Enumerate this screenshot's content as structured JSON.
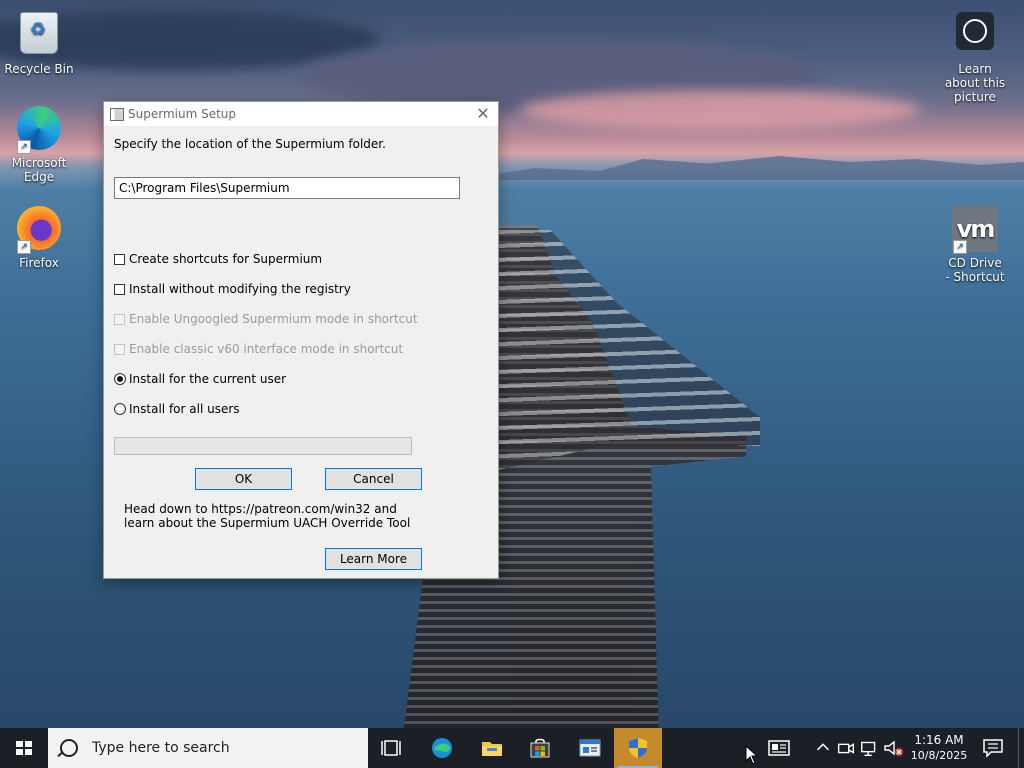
{
  "desktop": {
    "icons": [
      {
        "label": "Recycle Bin"
      },
      {
        "label": "Microsoft Edge"
      },
      {
        "label": "Firefox"
      },
      {
        "label": "Learn about this picture"
      },
      {
        "label": "CD Drive - Shortcut"
      }
    ]
  },
  "dialog": {
    "title": "Supermium Setup",
    "close_glyph": "✕",
    "prompt": "Specify the location of the Supermium folder.",
    "path_value": "C:\\Program Files\\Supermium",
    "options": [
      {
        "label": "Create shortcuts for Supermium",
        "type": "checkbox",
        "checked": false,
        "enabled": true
      },
      {
        "label": "Install without modifying the registry",
        "type": "checkbox",
        "checked": false,
        "enabled": true
      },
      {
        "label": "Enable Ungoogled Supermium mode in shortcut",
        "type": "checkbox",
        "checked": false,
        "enabled": false
      },
      {
        "label": "Enable classic v60 interface mode in shortcut",
        "type": "checkbox",
        "checked": false,
        "enabled": false
      },
      {
        "label": "Install for the current user",
        "type": "radio",
        "checked": true,
        "enabled": true
      },
      {
        "label": "Install for all users",
        "type": "radio",
        "checked": false,
        "enabled": true
      }
    ],
    "progress": 0,
    "ok_label": "OK",
    "cancel_label": "Cancel",
    "note_line1": "Head down to https://patreon.com/win32 and",
    "note_line2": "learn about the Supermium UACH Override Tool",
    "learn_more_label": "Learn More"
  },
  "taskbar": {
    "search_placeholder": "Type here to search",
    "pinned": [
      "task-view-icon",
      "edge-icon",
      "file-explorer-icon",
      "store-icon",
      "control-panel-icon",
      "setup-shield-icon"
    ],
    "time": "1:16 AM",
    "date": "10/8/2025"
  },
  "colors": {
    "accent": "#0078d7",
    "taskbar": "#1b1f26",
    "dialog_bg": "#f0f0f0"
  }
}
